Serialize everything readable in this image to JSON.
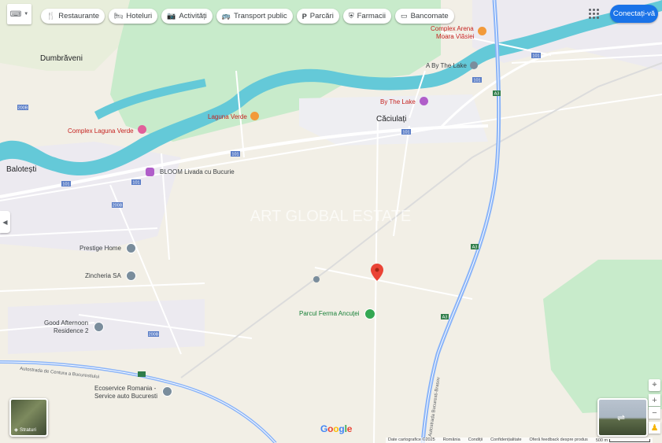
{
  "chips": [
    {
      "icon": "fork-knife-icon",
      "glyph": "🍴",
      "label": "Restaurante"
    },
    {
      "icon": "bed-icon",
      "glyph": "🛏",
      "label": "Hoteluri"
    },
    {
      "icon": "camera-icon",
      "glyph": "📷",
      "label": "Activități"
    },
    {
      "icon": "bus-icon",
      "glyph": "🚌",
      "label": "Transport public"
    },
    {
      "icon": "parking-icon",
      "glyph": "P",
      "label": "Parcări"
    },
    {
      "icon": "pharmacy-icon",
      "glyph": "⛨",
      "label": "Farmacii"
    },
    {
      "icon": "atm-icon",
      "glyph": "▭",
      "label": "Bancomate"
    }
  ],
  "header": {
    "signin_label": "Conectați-vă"
  },
  "places": {
    "dumbraveni": "Dumbrăveni",
    "caciulati": "Căciulați",
    "balotesti": "Balotești",
    "complex_arena": "Complex Arena",
    "moara_vlasiei": "Moara Vlăsiei",
    "by_the_lake_a": "A By The Lake",
    "by_the_lake": "By The Lake",
    "laguna_verde": "Laguna Verde",
    "complex_laguna": "Complex Laguna Verde",
    "bloom": "BLOOM Livada cu Bucurie",
    "prestige": "Prestige Home",
    "zincheria": "Zincheria SA",
    "good_afternoon_1": "Good Afternoon",
    "good_afternoon_2": "Residence 2",
    "parcul": "Parcul Ferma Ancuței",
    "ecoservice_1": "Ecoservice Romania -",
    "ecoservice_2": "Service auto Bucuresti",
    "watermark": "ART GLOBAL ESTATE"
  },
  "roads": {
    "r101": "101",
    "r200b": "200B",
    "a3": "A3",
    "centura": "Autostrada de Centura a Bucurestiului",
    "a3_name": "Autostrada Bucuresti-Brasov"
  },
  "controls": {
    "layers_label": "Straturi",
    "google": "Google",
    "zoom_in": "+",
    "zoom_out": "−"
  },
  "footer": {
    "map_data": "Date cartografice ©2025",
    "country": "România",
    "terms": "Condiții",
    "privacy": "Confidențialitate",
    "feedback": "Oferă feedback despre produs",
    "scale": "500 m"
  },
  "colors": {
    "water": "#64c9d8",
    "park": "#c8ebcb",
    "road": "#ffffff",
    "highway": "#8ab4f8",
    "pin": "#ea4335",
    "accent": "#1a73e8"
  }
}
